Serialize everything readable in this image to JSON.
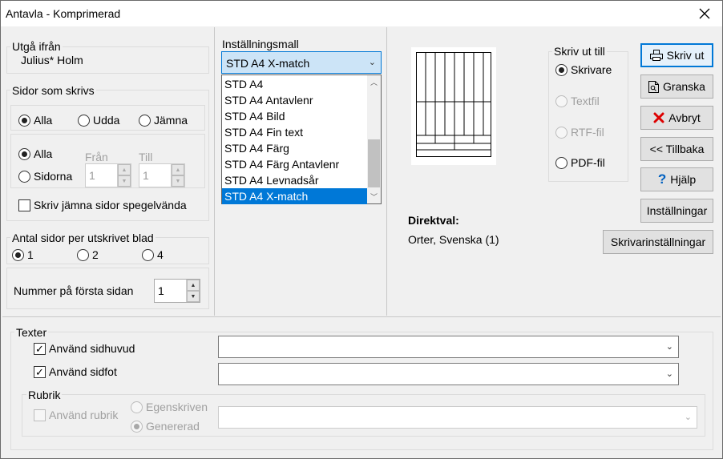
{
  "window": {
    "title": "Antavla - Komprimerad"
  },
  "utga": {
    "label": "Utgå ifrån",
    "value": "Julius* Holm"
  },
  "sidor": {
    "label": "Sidor som skrivs",
    "alla": "Alla",
    "udda": "Udda",
    "jamna": "Jämna",
    "range_alla": "Alla",
    "range_sidorna": "Sidorna",
    "fran_label": "Från",
    "till_label": "Till",
    "fran_value": "1",
    "till_value": "1",
    "spegel": "Skriv jämna sidor spegelvända"
  },
  "antal": {
    "label": "Antal sidor per utskrivet blad",
    "opt1": "1",
    "opt2": "2",
    "opt4": "4"
  },
  "nummer": {
    "label": "Nummer på första sidan",
    "value": "1"
  },
  "mall": {
    "label": "Inställningsmall",
    "selected": "STD A4 X-match",
    "options": [
      "STD A4",
      "STD A4 Antavlenr",
      "STD A4 Bild",
      "STD A4 Fin text",
      "STD A4 Färg",
      "STD A4 Färg Antavlenr",
      "STD A4 Levnadsår",
      "STD A4 X-match"
    ]
  },
  "skriv_ut_till": {
    "label": "Skriv ut till",
    "skrivare": "Skrivare",
    "textfil": "Textfil",
    "rtf": "RTF-fil",
    "pdf": "PDF-fil"
  },
  "direktval": {
    "label": "Direktval:",
    "value": "Orter, Svenska (1)"
  },
  "buttons": {
    "skriv_ut": "Skriv ut",
    "granska": "Granska",
    "avbryt": "Avbryt",
    "tillbaka": "<< Tillbaka",
    "hjalp": "Hjälp",
    "installningar": "Inställningar",
    "skrivarinstallningar": "Skrivarinställningar"
  },
  "texter": {
    "label": "Texter",
    "sidhuvud": "Använd sidhuvud",
    "sidfot": "Använd sidfot",
    "rubrik_label": "Rubrik",
    "anvand_rubrik": "Använd rubrik",
    "egenskriven": "Egenskriven",
    "genererad": "Genererad"
  }
}
